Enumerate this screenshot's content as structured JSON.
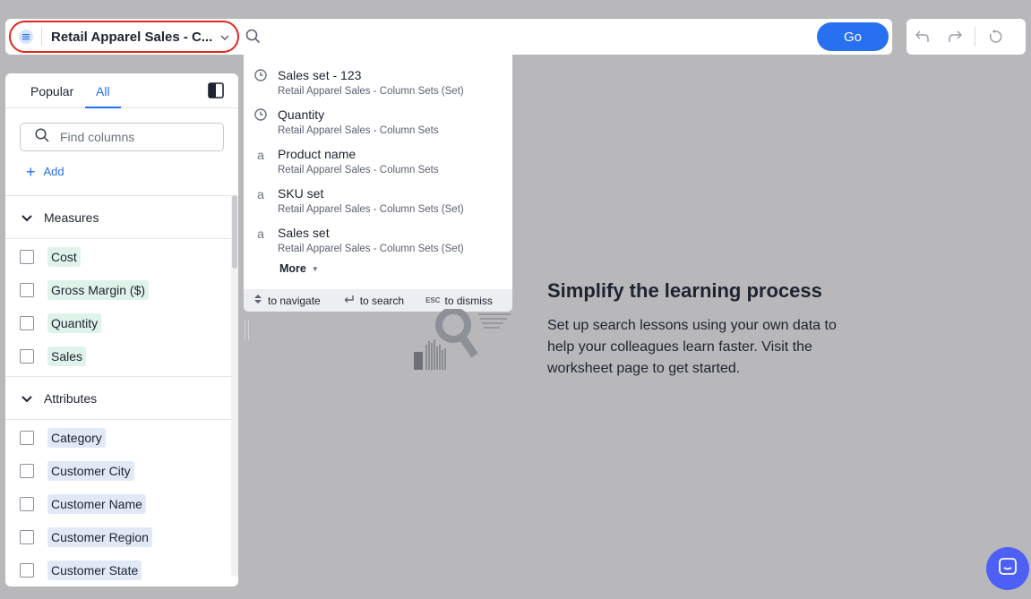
{
  "searchbar": {
    "source_name": "Retail Apparel Sales - C...",
    "go_label": "Go"
  },
  "panel": {
    "tabs": [
      {
        "label": "Popular",
        "active": false
      },
      {
        "label": "All",
        "active": true
      }
    ],
    "find_placeholder": "Find columns",
    "add_label": "Add",
    "sections": [
      {
        "title": "Measures",
        "items": [
          "Cost",
          "Gross Margin ($)",
          "Quantity",
          "Sales"
        ]
      },
      {
        "title": "Attributes",
        "items": [
          "Category",
          "Customer City",
          "Customer Name",
          "Customer Region",
          "Customer State"
        ]
      }
    ]
  },
  "dropdown": {
    "suggestions": [
      {
        "icon": "clock-icon",
        "title": "Sales set - 123",
        "subtitle": "Retail Apparel Sales - Column Sets (Set)"
      },
      {
        "icon": "clock-icon",
        "title": "Quantity",
        "subtitle": "Retail Apparel Sales - Column Sets"
      },
      {
        "icon": "attribute-icon",
        "title": "Product name",
        "subtitle": "Retail Apparel Sales - Column Sets"
      },
      {
        "icon": "attribute-icon",
        "title": "SKU set",
        "subtitle": "Retail Apparel Sales - Column Sets (Set)"
      },
      {
        "icon": "attribute-icon",
        "title": "Sales set",
        "subtitle": "Retail Apparel Sales - Column Sets (Set)"
      }
    ],
    "more_label": "More",
    "hints": {
      "navigate": "to navigate",
      "search": "to search",
      "esc_key": "ESC",
      "dismiss": "to dismiss"
    }
  },
  "empty_state": {
    "title": "Simplify the learning process",
    "body": "Set up search lessons using your own data to help your colleagues learn faster. Visit the worksheet page to get started."
  },
  "colors": {
    "accent": "#2770ef",
    "highlight_ring": "#e0271f",
    "measure_chip": "#dff3eb",
    "attribute_chip": "#e1e9f7",
    "chat_button": "#4d5ff5"
  }
}
